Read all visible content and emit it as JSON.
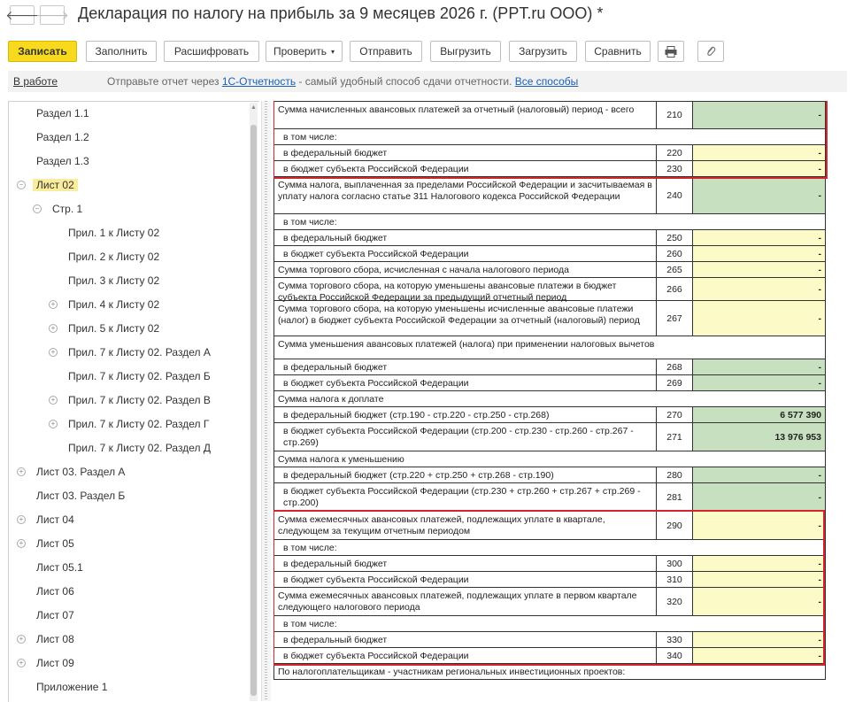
{
  "window": {
    "title": "Декларация по налогу на прибыль за 9 месяцев 2026 г. (PPT.ru ООО) *",
    "back_glyph": "🡐",
    "forward_glyph": "🡒"
  },
  "toolbar": {
    "write": "Записать",
    "fill": "Заполнить",
    "decode": "Расшифровать",
    "check": "Проверить",
    "send": "Отправить",
    "export": "Выгрузить",
    "import": "Загрузить",
    "compare": "Сравнить",
    "print_icon": "printer-icon",
    "attach_icon": "paperclip-icon"
  },
  "status": {
    "state": "В работе",
    "msg_prefix": "Отправьте отчет через ",
    "msg_link": "1С-Отчетность",
    "msg_mid": " - самый удобный способ сдачи отчетности. ",
    "msg_link2": "Все способы"
  },
  "tree": [
    {
      "label": "Раздел 1.1",
      "level": 1,
      "toggle": ""
    },
    {
      "label": "Раздел 1.2",
      "level": 1,
      "toggle": ""
    },
    {
      "label": "Раздел 1.3",
      "level": 1,
      "toggle": ""
    },
    {
      "label": "Лист 02",
      "level": 1,
      "toggle": "minus",
      "selected": true
    },
    {
      "label": "Стр. 1",
      "level": 2,
      "toggle": "minus"
    },
    {
      "label": "Прил. 1 к Листу 02",
      "level": 3,
      "toggle": ""
    },
    {
      "label": "Прил. 2 к Листу 02",
      "level": 3,
      "toggle": ""
    },
    {
      "label": "Прил. 3 к Листу 02",
      "level": 3,
      "toggle": ""
    },
    {
      "label": "Прил. 4 к Листу 02",
      "level": 3,
      "toggle": "plus"
    },
    {
      "label": "Прил. 5 к Листу 02",
      "level": 3,
      "toggle": "plus"
    },
    {
      "label": "Прил. 7 к Листу 02. Раздел А",
      "level": 3,
      "toggle": "plus"
    },
    {
      "label": "Прил. 7 к Листу 02. Раздел Б",
      "level": 3,
      "toggle": ""
    },
    {
      "label": "Прил. 7 к Листу 02. Раздел В",
      "level": 3,
      "toggle": "plus"
    },
    {
      "label": "Прил. 7 к Листу 02. Раздел Г",
      "level": 3,
      "toggle": "plus"
    },
    {
      "label": "Прил. 7 к Листу 02. Раздел Д",
      "level": 3,
      "toggle": ""
    },
    {
      "label": "Лист 03. Раздел А",
      "level": 1,
      "toggle": "plus"
    },
    {
      "label": "Лист 03. Раздел Б",
      "level": 1,
      "toggle": ""
    },
    {
      "label": "Лист 04",
      "level": 1,
      "toggle": "plus"
    },
    {
      "label": "Лист 05",
      "level": 1,
      "toggle": "plus"
    },
    {
      "label": "Лист 05.1",
      "level": 1,
      "toggle": ""
    },
    {
      "label": "Лист 06",
      "level": 1,
      "toggle": ""
    },
    {
      "label": "Лист 07",
      "level": 1,
      "toggle": ""
    },
    {
      "label": "Лист 08",
      "level": 1,
      "toggle": "plus"
    },
    {
      "label": "Лист 09",
      "level": 1,
      "toggle": "plus"
    },
    {
      "label": "Приложение 1",
      "level": 1,
      "toggle": ""
    }
  ],
  "form_rows": [
    {
      "type": "line",
      "label": "Сумма начисленных авансовых платежей за отчетный (налоговый) период - всего",
      "code": "210",
      "value": "-",
      "fill": "green"
    },
    {
      "type": "header",
      "label": "в том числе:"
    },
    {
      "type": "line",
      "label": "в федеральный бюджет",
      "code": "220",
      "value": "-",
      "fill": "yellow",
      "indent": true
    },
    {
      "type": "line",
      "label": "в бюджет субъекта Российской Федерации",
      "code": "230",
      "value": "-",
      "fill": "yellow",
      "indent": true
    },
    {
      "type": "line",
      "label": "Сумма налога, выплаченная за пределами Российской Федерации и засчитываемая в уплату налога согласно статье 311 Налогового кодекса Российской Федерации",
      "code": "240",
      "value": "-",
      "fill": "green"
    },
    {
      "type": "header",
      "label": "в том числе:"
    },
    {
      "type": "line",
      "label": "в федеральный бюджет",
      "code": "250",
      "value": "-",
      "fill": "yellow",
      "indent": true
    },
    {
      "type": "line",
      "label": "в бюджет субъекта Российской Федерации",
      "code": "260",
      "value": "-",
      "fill": "yellow",
      "indent": true
    },
    {
      "type": "line",
      "label": "Сумма торгового сбора, исчисленная с начала налогового периода",
      "code": "265",
      "value": "-",
      "fill": "yellow"
    },
    {
      "type": "line",
      "label": "Сумма торгового сбора, на которую уменьшены авансовые платежи в бюджет субъекта Российской Федерации за предыдущий отчетный период",
      "code": "266",
      "value": "-",
      "fill": "yellow"
    },
    {
      "type": "line",
      "label": "Сумма торгового сбора, на которую уменьшены исчисленные авансовые платежи (налог) в бюджет субъекта Российской Федерации за отчетный (налоговый) период",
      "code": "267",
      "value": "-",
      "fill": "yellow"
    },
    {
      "type": "header",
      "label": "Сумма уменьшения авансовых платежей (налога) при применении налоговых вычетов"
    },
    {
      "type": "line",
      "label": "в федеральный бюджет",
      "code": "268",
      "value": "-",
      "fill": "green",
      "indent": true
    },
    {
      "type": "line",
      "label": "в бюджет субъекта Российской Федерации",
      "code": "269",
      "value": "-",
      "fill": "green",
      "indent": true
    },
    {
      "type": "header",
      "label": "Сумма налога к доплате"
    },
    {
      "type": "line",
      "label": "в федеральный бюджет (стр.190 - стр.220 - стр.250 - стр.268)",
      "code": "270",
      "value": "6 577 390",
      "fill": "green",
      "indent": true
    },
    {
      "type": "line",
      "label": "в бюджет субъекта Российской Федерации (стр.200 - стр.230 - стр.260 - стр.267 - стр.269)",
      "code": "271",
      "value": "13 976 953",
      "fill": "green",
      "indent": true
    },
    {
      "type": "header",
      "label": "Сумма налога к уменьшению"
    },
    {
      "type": "line",
      "label": "в федеральный бюджет (стр.220 + стр.250 + стр.268 - стр.190)",
      "code": "280",
      "value": "-",
      "fill": "green",
      "indent": true
    },
    {
      "type": "line",
      "label": "в бюджет субъекта Российской Федерации (стр.230 + стр.260 + стр.267 + стр.269 - стр.200)",
      "code": "281",
      "value": "-",
      "fill": "green",
      "indent": true
    },
    {
      "type": "line",
      "label": "Сумма ежемесячных авансовых платежей, подлежащих уплате в квартале, следующем за текущим отчетным периодом",
      "code": "290",
      "value": "-",
      "fill": "yellow"
    },
    {
      "type": "header",
      "label": "в том числе:"
    },
    {
      "type": "line",
      "label": "в федеральный бюджет",
      "code": "300",
      "value": "-",
      "fill": "yellow",
      "indent": true
    },
    {
      "type": "line",
      "label": "в бюджет субъекта Российской Федерации",
      "code": "310",
      "value": "-",
      "fill": "yellow",
      "indent": true
    },
    {
      "type": "line",
      "label": "Сумма ежемесячных авансовых платежей, подлежащих уплате в первом квартале следующего налогового периода",
      "code": "320",
      "value": "-",
      "fill": "yellow"
    },
    {
      "type": "header",
      "label": "в том числе:"
    },
    {
      "type": "line",
      "label": "в федеральный бюджет",
      "code": "330",
      "value": "-",
      "fill": "yellow",
      "indent": true
    },
    {
      "type": "line",
      "label": "в бюджет субъекта Российской Федерации",
      "code": "340",
      "value": "-",
      "fill": "yellow",
      "indent": true
    },
    {
      "type": "header",
      "label": "По налогоплательщикам - участникам региональных инвестиционных проектов:"
    }
  ],
  "colors": {
    "accent_button": "#f7da1e",
    "highlight_box": "#d5242e",
    "cell_green": "#c7e1c0",
    "cell_yellow": "#fcfac6",
    "tree_selected": "#f9ec9c"
  }
}
